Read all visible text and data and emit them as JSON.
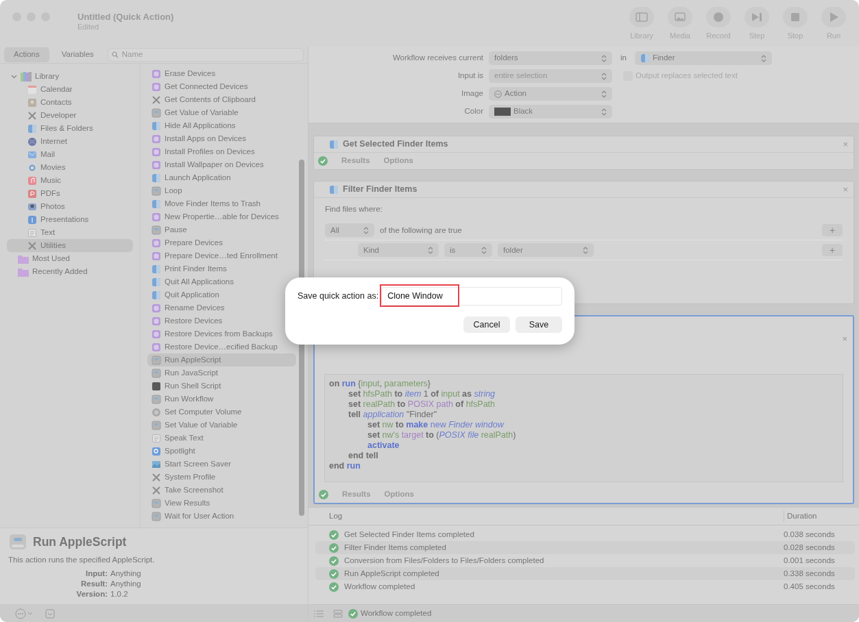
{
  "window": {
    "title": "Untitled (Quick Action)",
    "subtitle": "Edited"
  },
  "toolbar": [
    {
      "label": "Library",
      "kind": "library"
    },
    {
      "label": "Media",
      "kind": "media"
    },
    {
      "label": "Record",
      "kind": "record"
    },
    {
      "label": "Step",
      "kind": "step"
    },
    {
      "label": "Stop",
      "kind": "stop"
    },
    {
      "label": "Run",
      "kind": "run"
    }
  ],
  "tabs": [
    {
      "label": "Actions",
      "selected": true
    },
    {
      "label": "Variables",
      "selected": false
    }
  ],
  "search": {
    "placeholder": "Name"
  },
  "library": {
    "label": "Library",
    "expanded": true,
    "children": [
      {
        "label": "Calendar",
        "kind": "calendar",
        "selected": false
      },
      {
        "label": "Contacts",
        "kind": "contacts",
        "selected": false
      },
      {
        "label": "Developer",
        "kind": "tools",
        "selected": false
      },
      {
        "label": "Files & Folders",
        "kind": "finder",
        "selected": false
      },
      {
        "label": "Internet",
        "kind": "globe",
        "selected": false
      },
      {
        "label": "Mail",
        "kind": "mail",
        "selected": false
      },
      {
        "label": "Movies",
        "kind": "movies",
        "selected": false
      },
      {
        "label": "Music",
        "kind": "music",
        "selected": false
      },
      {
        "label": "PDFs",
        "kind": "pdf",
        "selected": false
      },
      {
        "label": "Photos",
        "kind": "photos",
        "selected": false
      },
      {
        "label": "Presentations",
        "kind": "presentation",
        "selected": false
      },
      {
        "label": "Text",
        "kind": "text",
        "selected": false
      },
      {
        "label": "Utilities",
        "kind": "tools",
        "selected": true
      }
    ]
  },
  "smart_groups": [
    {
      "label": "Most Used"
    },
    {
      "label": "Recently Added"
    }
  ],
  "actions": [
    {
      "label": "Erase Devices",
      "kind": "device",
      "selected": false
    },
    {
      "label": "Get Connected Devices",
      "kind": "device",
      "selected": false
    },
    {
      "label": "Get Contents of Clipboard",
      "kind": "tools",
      "selected": false
    },
    {
      "label": "Get Value of Variable",
      "kind": "automator",
      "selected": false
    },
    {
      "label": "Hide All Applications",
      "kind": "finder",
      "selected": false
    },
    {
      "label": "Install Apps on Devices",
      "kind": "device",
      "selected": false
    },
    {
      "label": "Install Profiles on Devices",
      "kind": "device",
      "selected": false
    },
    {
      "label": "Install Wallpaper on Devices",
      "kind": "device",
      "selected": false
    },
    {
      "label": "Launch Application",
      "kind": "finder",
      "selected": false
    },
    {
      "label": "Loop",
      "kind": "automator",
      "selected": false
    },
    {
      "label": "Move Finder Items to Trash",
      "kind": "finder",
      "selected": false
    },
    {
      "label": "New Propertie…able for Devices",
      "kind": "device",
      "selected": false
    },
    {
      "label": "Pause",
      "kind": "automator",
      "selected": false
    },
    {
      "label": "Prepare Devices",
      "kind": "device",
      "selected": false
    },
    {
      "label": "Prepare Device…ted Enrollment",
      "kind": "device",
      "selected": false
    },
    {
      "label": "Print Finder Items",
      "kind": "finder",
      "selected": false
    },
    {
      "label": "Quit All Applications",
      "kind": "finder",
      "selected": false
    },
    {
      "label": "Quit Application",
      "kind": "finder",
      "selected": false
    },
    {
      "label": "Rename Devices",
      "kind": "device",
      "selected": false
    },
    {
      "label": "Restore Devices",
      "kind": "device",
      "selected": false
    },
    {
      "label": "Restore Devices from Backups",
      "kind": "device",
      "selected": false
    },
    {
      "label": "Restore Device…ecified Backup",
      "kind": "device",
      "selected": false
    },
    {
      "label": "Run AppleScript",
      "kind": "automator",
      "selected": true
    },
    {
      "label": "Run JavaScript",
      "kind": "automator",
      "selected": false
    },
    {
      "label": "Run Shell Script",
      "kind": "terminal",
      "selected": false
    },
    {
      "label": "Run Workflow",
      "kind": "automator",
      "selected": false
    },
    {
      "label": "Set Computer Volume",
      "kind": "volume",
      "selected": false
    },
    {
      "label": "Set Value of Variable",
      "kind": "automator",
      "selected": false
    },
    {
      "label": "Speak Text",
      "kind": "text",
      "selected": false
    },
    {
      "label": "Spotlight",
      "kind": "spotlight",
      "selected": false
    },
    {
      "label": "Start Screen Saver",
      "kind": "screensaver",
      "selected": false
    },
    {
      "label": "System Profile",
      "kind": "tools",
      "selected": false
    },
    {
      "label": "Take Screenshot",
      "kind": "tools",
      "selected": false
    },
    {
      "label": "View Results",
      "kind": "automator",
      "selected": false
    },
    {
      "label": "Wait for User Action",
      "kind": "automator",
      "selected": false
    }
  ],
  "description": {
    "title": "Run AppleScript",
    "text": "This action runs the specified AppleScript.",
    "fields": [
      {
        "label": "Input:",
        "value": "Anything"
      },
      {
        "label": "Result:",
        "value": "Anything"
      },
      {
        "label": "Version:",
        "value": "1.0.2"
      }
    ]
  },
  "settings": {
    "receives_label": "Workflow receives current",
    "receives": "folders",
    "in_label": "in",
    "app": "Finder",
    "input_label": "Input is",
    "input": "entire selection",
    "input_disabled": true,
    "output_replaces": {
      "label": "Output replaces selected text",
      "checked": false,
      "disabled": true
    },
    "image_label": "Image",
    "image": "Action",
    "color_label": "Color",
    "color_name": "Black",
    "color": "#555555"
  },
  "workflow": [
    {
      "title": "Get Selected Finder Items",
      "kind": "plain",
      "close": "×",
      "footer": [
        "Results",
        "Options"
      ]
    },
    {
      "title": "Filter Finder Items",
      "kind": "filter",
      "close": "×",
      "find_label": "Find files where:",
      "match": "All",
      "match_text": "of the following are true",
      "match_add": "+",
      "criteria": [
        {
          "field": "Kind",
          "op": "is",
          "value": "folder",
          "add": "+"
        }
      ]
    },
    {
      "kind": "script",
      "close": "×",
      "selected": true,
      "footer": [
        "Results",
        "Options"
      ],
      "code": [
        {
          "tokens": [
            {
              "kind": "keyword",
              "t": "on "
            },
            {
              "kind": "handler",
              "t": "run "
            },
            {
              "kind": "plain",
              "t": "{"
            },
            {
              "kind": "variable",
              "t": "input"
            },
            {
              "kind": "plain",
              "t": ", "
            },
            {
              "kind": "variable",
              "t": "parameters"
            },
            {
              "kind": "plain",
              "t": "}"
            }
          ],
          "children": [
            {
              "tokens": [
                {
                  "kind": "keyword",
                  "t": "set "
                },
                {
                  "kind": "variable",
                  "t": "hfsPath "
                },
                {
                  "kind": "keyword",
                  "t": "to "
                },
                {
                  "kind": "class",
                  "t": "item "
                },
                {
                  "kind": "plain",
                  "t": "1 "
                },
                {
                  "kind": "keyword",
                  "t": "of "
                },
                {
                  "kind": "variable",
                  "t": "input "
                },
                {
                  "kind": "keyword",
                  "t": "as "
                },
                {
                  "kind": "class",
                  "t": "string"
                }
              ]
            },
            {
              "tokens": [
                {
                  "kind": "keyword",
                  "t": "set "
                },
                {
                  "kind": "variable",
                  "t": "realPath "
                },
                {
                  "kind": "keyword",
                  "t": "to "
                },
                {
                  "kind": "property",
                  "t": "POSIX path "
                },
                {
                  "kind": "keyword",
                  "t": "of "
                },
                {
                  "kind": "variable",
                  "t": "hfsPath"
                }
              ]
            },
            {
              "tokens": [
                {
                  "kind": "keyword",
                  "t": "tell "
                },
                {
                  "kind": "class",
                  "t": "application "
                },
                {
                  "kind": "plain",
                  "t": "\"Finder\""
                }
              ],
              "children": [
                {
                  "tokens": [
                    {
                      "kind": "keyword",
                      "t": "set "
                    },
                    {
                      "kind": "variable",
                      "t": "nw "
                    },
                    {
                      "kind": "keyword",
                      "t": "to "
                    },
                    {
                      "kind": "handler",
                      "t": "make "
                    },
                    {
                      "kind": "term",
                      "t": "new "
                    },
                    {
                      "kind": "class",
                      "t": "Finder window"
                    }
                  ]
                },
                {
                  "tokens": [
                    {
                      "kind": "keyword",
                      "t": "set "
                    },
                    {
                      "kind": "variable",
                      "t": "nw's "
                    },
                    {
                      "kind": "property",
                      "t": "target "
                    },
                    {
                      "kind": "keyword",
                      "t": "to "
                    },
                    {
                      "kind": "plain",
                      "t": "("
                    },
                    {
                      "kind": "class",
                      "t": "POSIX file "
                    },
                    {
                      "kind": "variable",
                      "t": "realPath"
                    },
                    {
                      "kind": "plain",
                      "t": ")"
                    }
                  ]
                },
                {
                  "tokens": [
                    {
                      "kind": "handler",
                      "t": "activate"
                    }
                  ]
                }
              ]
            },
            {
              "tokens": [
                {
                  "kind": "keyword",
                  "t": "end tell"
                }
              ]
            }
          ]
        },
        {
          "tokens": [
            {
              "kind": "keyword",
              "t": "end "
            },
            {
              "kind": "handler",
              "t": "run"
            }
          ]
        }
      ]
    }
  ],
  "log": {
    "columns": [
      "Log",
      "Duration"
    ],
    "rows": [
      {
        "text": "Get Selected Finder Items completed",
        "duration": "0.038 seconds"
      },
      {
        "text": "Filter Finder Items completed",
        "duration": "0.028 seconds"
      },
      {
        "text": "Conversion from Files/Folders to Files/Folders completed",
        "duration": "0.001 seconds"
      },
      {
        "text": "Run AppleScript completed",
        "duration": "0.338 seconds"
      },
      {
        "text": "Workflow completed",
        "duration": "0.405 seconds"
      }
    ]
  },
  "status_bar": {
    "text": "Workflow completed"
  },
  "dialog": {
    "label": "Save quick action as:",
    "value": "Clone Window",
    "highlighted": true,
    "buttons": [
      "Cancel",
      "Save"
    ]
  }
}
